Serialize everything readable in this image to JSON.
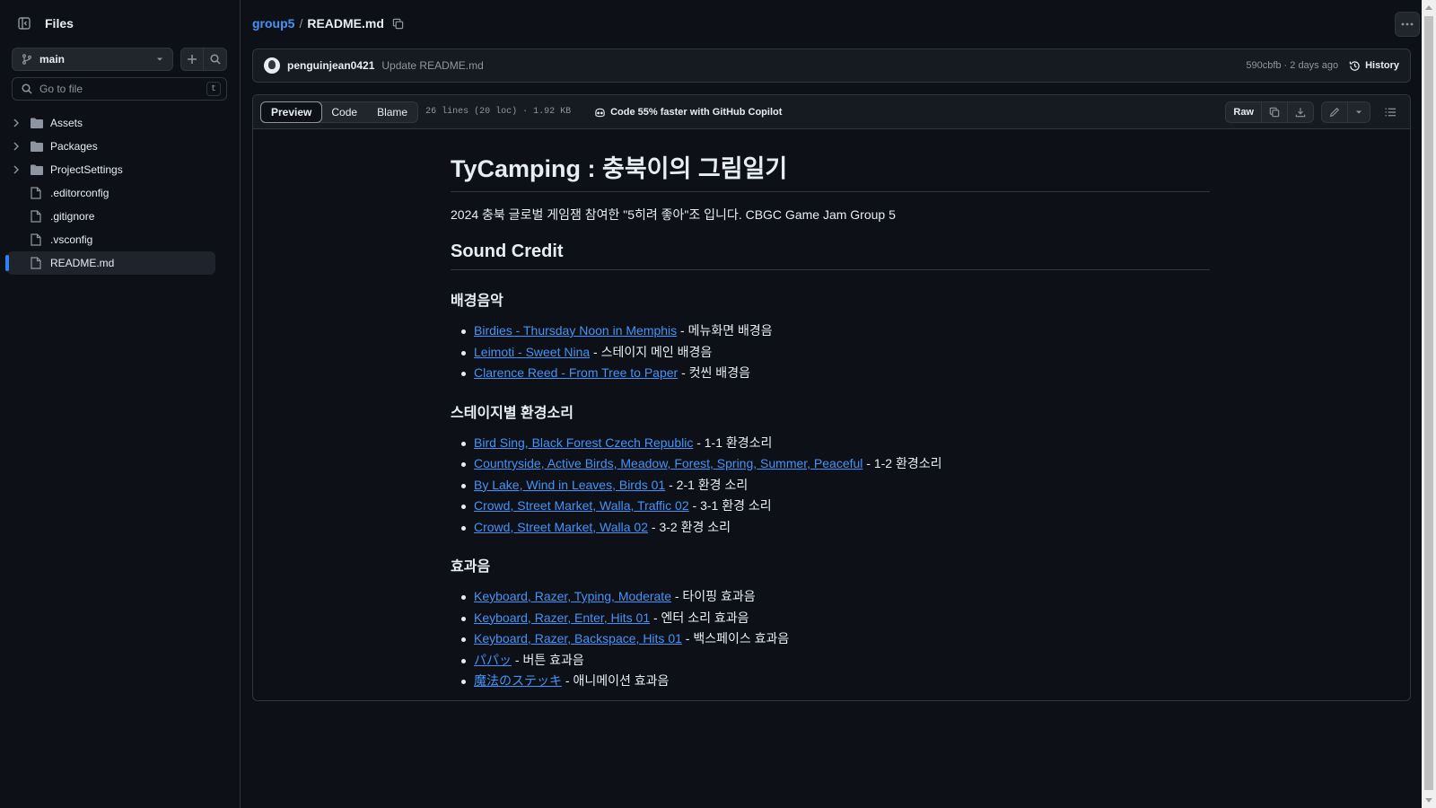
{
  "sidebar": {
    "title": "Files",
    "branch": "main",
    "goto_placeholder": "Go to file",
    "goto_shortcut": "t",
    "tree": [
      {
        "name": "Assets",
        "type": "folder"
      },
      {
        "name": "Packages",
        "type": "folder"
      },
      {
        "name": "ProjectSettings",
        "type": "folder"
      },
      {
        "name": ".editorconfig",
        "type": "file"
      },
      {
        "name": ".gitignore",
        "type": "file"
      },
      {
        "name": ".vsconfig",
        "type": "file"
      },
      {
        "name": "README.md",
        "type": "file",
        "active": true
      }
    ]
  },
  "breadcrumb": {
    "repo": "group5",
    "sep": "/",
    "file": "README.md"
  },
  "commit": {
    "author": "penguinjean0421",
    "message": "Update README.md",
    "meta": "590cbfb · 2 days ago",
    "history_label": "History"
  },
  "toolbar": {
    "tabs": [
      "Preview",
      "Code",
      "Blame"
    ],
    "active_tab": "Preview",
    "file_meta": "26 lines (20 loc) · 1.92 KB",
    "copilot": "Code 55% faster with GitHub Copilot",
    "raw_label": "Raw"
  },
  "readme": {
    "title": "TyCamping : 충북이의 그림일기",
    "intro": "2024 충북 글로벌 게임잼 참여한 \"5히려 좋아\"조 입니다. CBGC Game Jam Group 5",
    "section": "Sound Credit",
    "groups": [
      {
        "heading": "배경음악",
        "items": [
          {
            "link": "Birdies - Thursday Noon in Memphis",
            "desc": " - 메뉴화면 배경음"
          },
          {
            "link": "Leimoti - Sweet Nina",
            "desc": " - 스테이지 메인 배경음"
          },
          {
            "link": "Clarence Reed - From Tree to Paper",
            "desc": " - 컷씬 배경음"
          }
        ]
      },
      {
        "heading": "스테이지별 환경소리",
        "items": [
          {
            "link": "Bird Sing, Black Forest Czech Republic",
            "desc": " - 1-1 환경소리"
          },
          {
            "link": "Countryside, Active Birds, Meadow, Forest, Spring, Summer, Peaceful",
            "desc": " - 1-2 환경소리"
          },
          {
            "link": "By Lake, Wind in Leaves, Birds 01",
            "desc": " - 2-1 환경 소리"
          },
          {
            "link": "Crowd, Street Market, Walla, Traffic 02",
            "desc": " - 3-1 환경 소리"
          },
          {
            "link": "Crowd, Street Market, Walla 02",
            "desc": " - 3-2 환경 소리"
          }
        ]
      },
      {
        "heading": "효과음",
        "items": [
          {
            "link": "Keyboard, Razer, Typing, Moderate",
            "desc": " - 타이핑 효과음"
          },
          {
            "link": "Keyboard, Razer, Enter, Hits 01",
            "desc": " - 엔터 소리 효과음"
          },
          {
            "link": "Keyboard, Razer, Backspace, Hits 01",
            "desc": " - 백스페이스 효과음"
          },
          {
            "link": "パパッ",
            "desc": " - 버튼 효과음"
          },
          {
            "link": "魔法のステッキ",
            "desc": " - 애니메이션 효과음"
          }
        ]
      }
    ]
  },
  "colors": {
    "background": "#0d1117",
    "link": "#4493f8",
    "border": "#30363d",
    "accent": "#2f81f7"
  }
}
